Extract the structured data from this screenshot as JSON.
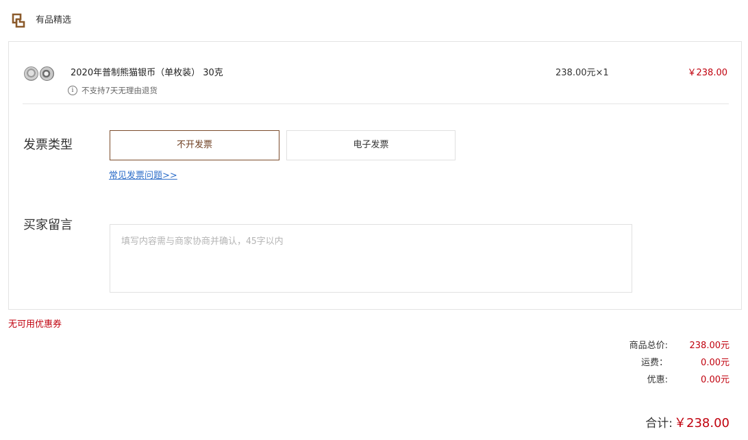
{
  "shop": {
    "logo_icon": "brand-logo-icon",
    "name": "有品精选"
  },
  "product": {
    "title": "2020年普制熊猫银币（单枚装） 30克",
    "return_policy": "不支持7天无理由退货",
    "unit_price": "238.00元×1",
    "line_total": "￥238.00"
  },
  "invoice": {
    "label": "发票类型",
    "options": [
      "不开发票",
      "电子发票"
    ],
    "selected": "不开发票",
    "faq_link": "常见发票问题>>"
  },
  "message": {
    "label": "买家留言",
    "placeholder": "填写内容需与商家协商并确认，45字以内"
  },
  "coupon": {
    "note": "无可用优惠券"
  },
  "summary": {
    "subtotal_label": "商品总价:",
    "subtotal_value": "238.00元",
    "shipping_label": "运费：",
    "shipping_value": "0.00元",
    "discount_label": "优惠:",
    "discount_value": "0.00元",
    "total_label": "合计:",
    "total_value": "￥238.00"
  },
  "colors": {
    "accent_red": "#c0000d",
    "brand_brown": "#7a4a2a",
    "link_blue": "#2d6ec9"
  }
}
